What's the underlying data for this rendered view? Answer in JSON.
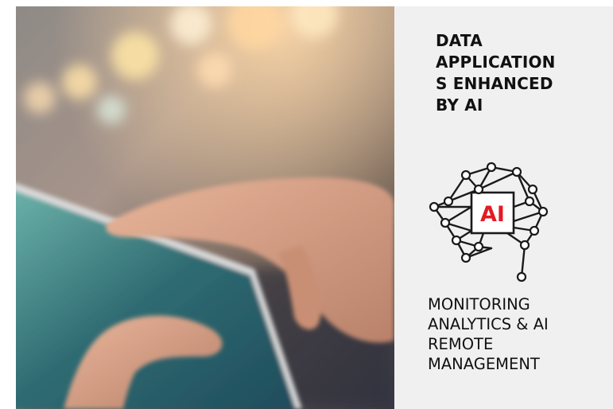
{
  "panel": {
    "title": "DATA\nAPPLICATION\nS ENHANCED\nBY AI",
    "icon": {
      "name": "ai-brain-icon",
      "label": "AI",
      "label_color": "#e31b23"
    },
    "features": [
      "MONITORING",
      "ANALYTICS & AI",
      "REMOTE",
      "MANAGEMENT"
    ]
  },
  "photo": {
    "subject": "hand-using-tablet-photo"
  },
  "colors": {
    "panel_background": "#f0f0f0",
    "text": "#111111",
    "accent": "#e31b23"
  }
}
